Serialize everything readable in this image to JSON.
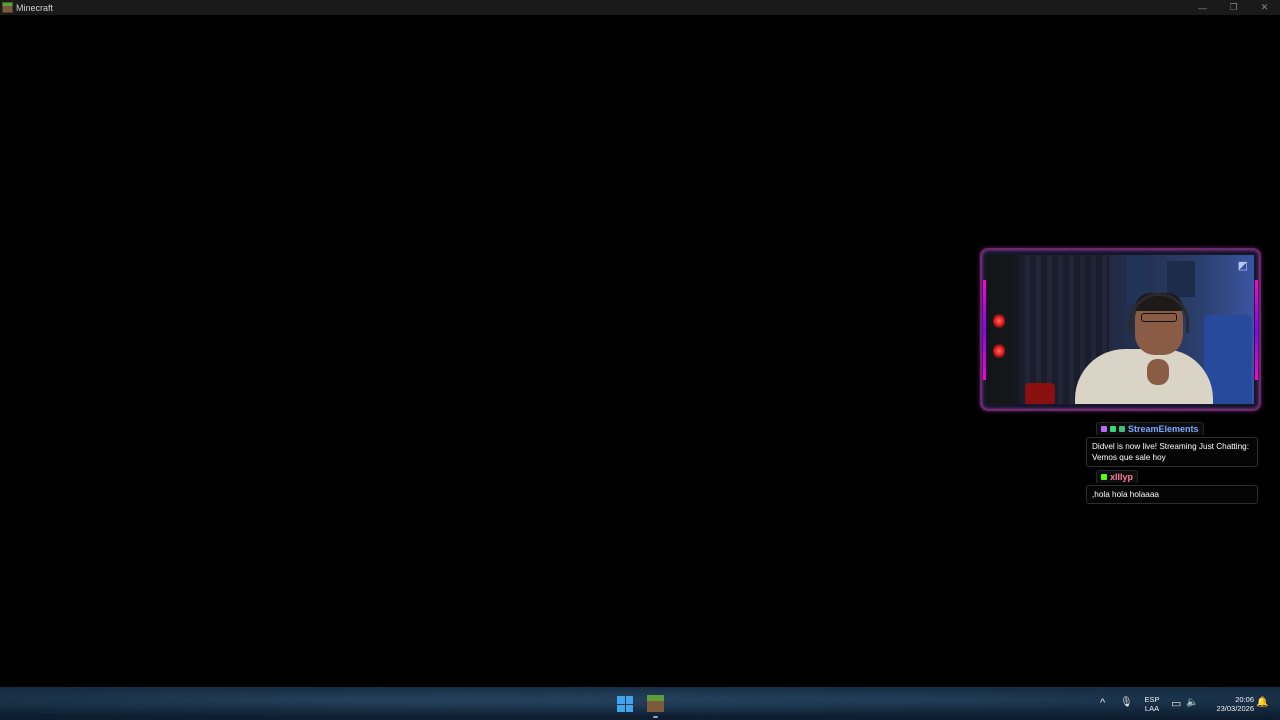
{
  "window": {
    "title": "Minecraft",
    "controls": {
      "minimize": "—",
      "restore": "❐",
      "close": "✕"
    }
  },
  "webcam": {
    "corner_glyph": "◩"
  },
  "chat": {
    "messages": [
      {
        "username": "StreamElements",
        "username_color": "#7aa7ff",
        "badge_colors": [
          "#b86cff",
          "#37d67a",
          "#3fbf7f"
        ],
        "text": "Didvel is now live! Streaming Just Chatting: Vemos que sale hoy"
      },
      {
        "username": "xlllyp",
        "username_color": "#ff7c9e",
        "badge_colors": [
          "#53fc18"
        ],
        "text": ",hola hola holaaaa"
      }
    ]
  },
  "taskbar": {
    "apps": [
      "start-menu",
      "minecraft"
    ],
    "tray": {
      "overflow_icon": "^",
      "mic_icon": "🎙",
      "language_top": "ESP",
      "language_bottom": "LAA",
      "network_icon": "▭",
      "volume_icon": "🔈",
      "time": "20:06",
      "date": "23/03/2026",
      "notification_icon": "🔔"
    }
  }
}
